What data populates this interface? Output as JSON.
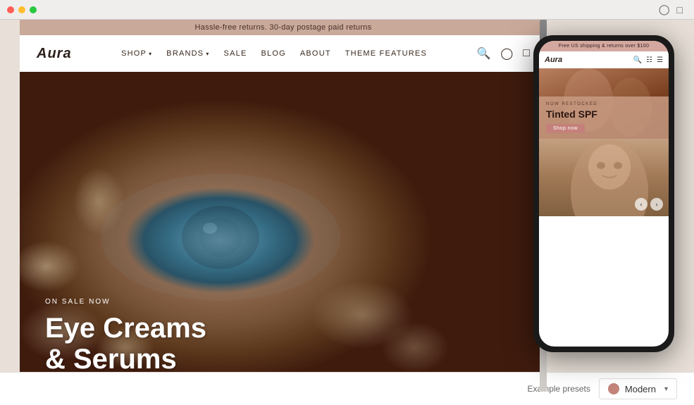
{
  "browser": {
    "social_icons": [
      "instagram-icon",
      "facebook-icon"
    ],
    "scrollbar": {
      "thumb_top": 0
    }
  },
  "announcement": {
    "text": "Hassle-free returns. 30-day postage paid returns"
  },
  "nav": {
    "logo": "Aura",
    "links": [
      {
        "label": "SHOP",
        "has_dropdown": true
      },
      {
        "label": "BRANDS",
        "has_dropdown": true
      },
      {
        "label": "SALE",
        "has_dropdown": false
      },
      {
        "label": "BLOG",
        "has_dropdown": false
      },
      {
        "label": "ABOUT",
        "has_dropdown": false
      },
      {
        "label": "THEME FEATURES",
        "has_dropdown": false
      }
    ],
    "icons": [
      "search-icon",
      "account-icon",
      "cart-icon"
    ]
  },
  "hero": {
    "subtitle": "ON SALE NOW",
    "title_line1": "Eye Creams",
    "title_line2": "& Serums"
  },
  "mobile_preview": {
    "announcement": "Free US shipping & returns over $100",
    "logo": "Aura",
    "hero1": {
      "badge_label": "NOW RESTOCKED",
      "title": "Tinted SPF",
      "button": "Shop now"
    },
    "nav_arrows": [
      "←",
      "→"
    ]
  },
  "bottom_bar": {
    "preset_label": "Example presets",
    "preset_name": "Modern",
    "preset_color": "#c4847a"
  }
}
